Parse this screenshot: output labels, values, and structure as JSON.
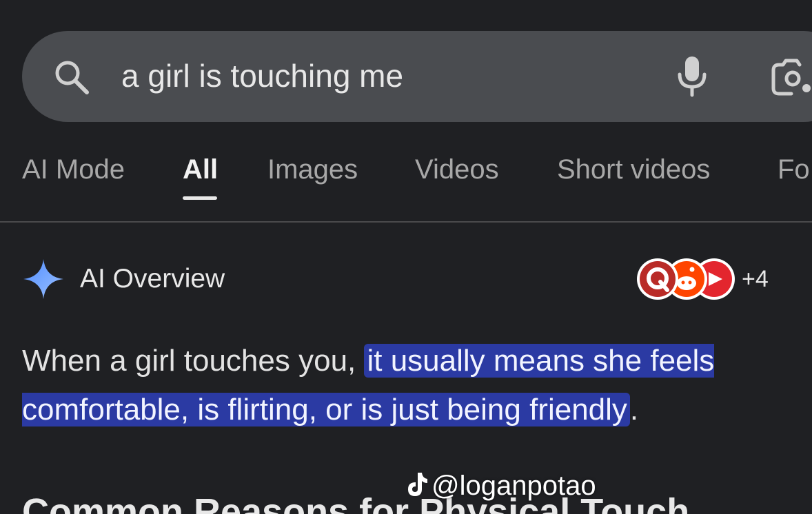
{
  "search": {
    "query": "a girl is touching me",
    "icons": [
      "search-icon",
      "mic-icon",
      "camera-icon"
    ]
  },
  "tabs": [
    {
      "label": "AI Mode",
      "active": false
    },
    {
      "label": "All",
      "active": true
    },
    {
      "label": "Images",
      "active": false
    },
    {
      "label": "Videos",
      "active": false
    },
    {
      "label": "Short videos",
      "active": false
    },
    {
      "label": "Fo",
      "active": false
    }
  ],
  "ai_overview": {
    "title": "AI Overview",
    "source_count": "+4",
    "answer_plain": "When a girl touches you, ",
    "answer_highlight": "it usually means she feels comfortable, is flirting, or is just being friendly",
    "answer_end": "."
  },
  "section": {
    "heading": "Common Reasons for Physical Touch"
  },
  "watermark": {
    "handle": "@loganpotao"
  },
  "colors": {
    "background": "#1f2023",
    "search_bar": "#4a4c50",
    "highlight": "#2b3aa3",
    "sparkle": "#6ea6ff"
  }
}
